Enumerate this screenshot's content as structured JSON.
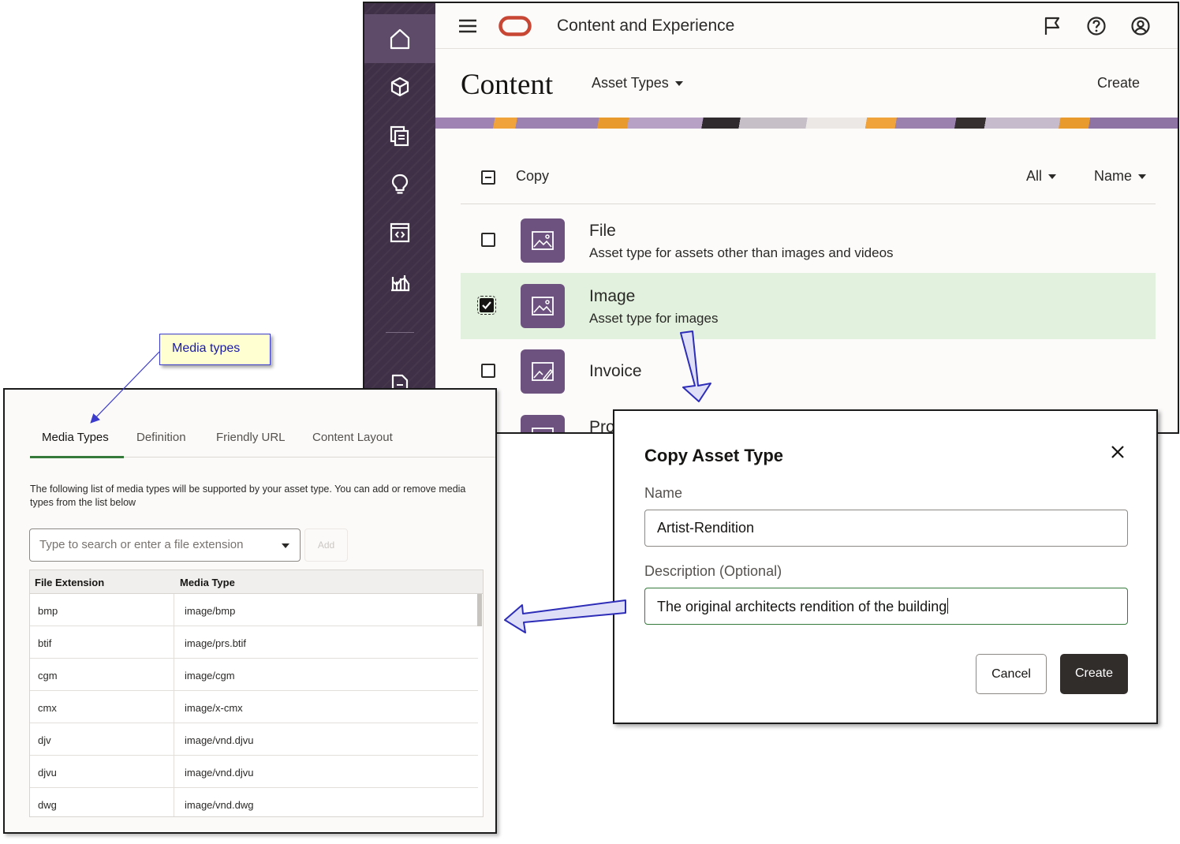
{
  "app": {
    "title": "Content and Experience",
    "brand_color": "#c74634",
    "rail_color": "#3f3047",
    "rail_icons": [
      "home-icon",
      "box-icon",
      "collections-icon",
      "lightbulb-icon",
      "developer-icon",
      "analytics-icon",
      "document-icon"
    ],
    "top_icons": [
      "flag-icon",
      "help-icon",
      "user-avatar-icon"
    ]
  },
  "content_page": {
    "title": "Content",
    "view_selector": "Asset Types",
    "create_label": "Create",
    "toolbar": {
      "action_label": "Copy",
      "filter_label": "All",
      "sort_label": "Name"
    },
    "assets": [
      {
        "name": "File",
        "description": "Asset type for assets other than images and videos",
        "checked": false
      },
      {
        "name": "Image",
        "description": "Asset type for images",
        "checked": true
      },
      {
        "name": "Invoice",
        "description": "",
        "checked": false
      },
      {
        "name": "Pro",
        "description": "",
        "checked": false
      }
    ],
    "selected_row_color": "#e2f1dd"
  },
  "callout": {
    "text": "Media types"
  },
  "media_panel": {
    "tabs": [
      "Media Types",
      "Definition",
      "Friendly URL",
      "Content Layout"
    ],
    "active_tab": "Media Types",
    "intro": "The following list of media types will be supported by your asset type. You can add or remove media types from the list below",
    "search_placeholder": "Type to search or enter a file extension",
    "add_label": "Add",
    "columns": [
      "File Extension",
      "Media Type"
    ],
    "rows": [
      {
        "ext": "bmp",
        "type": "image/bmp"
      },
      {
        "ext": "btif",
        "type": "image/prs.btif"
      },
      {
        "ext": "cgm",
        "type": "image/cgm"
      },
      {
        "ext": "cmx",
        "type": "image/x-cmx"
      },
      {
        "ext": "djv",
        "type": "image/vnd.djvu"
      },
      {
        "ext": "djvu",
        "type": "image/vnd.djvu"
      },
      {
        "ext": "dwg",
        "type": "image/vnd.dwg"
      }
    ],
    "accent_color": "#357a3b"
  },
  "dialog": {
    "title": "Copy Asset Type",
    "name_label": "Name",
    "name_value": "Artist-Rendition",
    "description_label": "Description (Optional)",
    "description_value": "The original architects rendition of the building",
    "cancel_label": "Cancel",
    "create_label": "Create"
  }
}
